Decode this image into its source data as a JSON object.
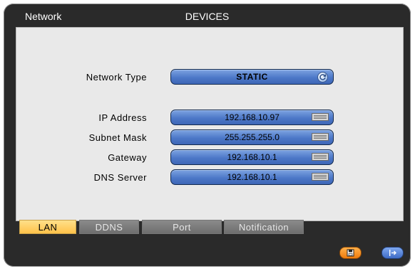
{
  "header": {
    "section": "Network",
    "title": "DEVICES"
  },
  "form": {
    "network_type": {
      "label": "Network Type",
      "value": "STATIC"
    },
    "ip_address": {
      "label": "IP Address",
      "value": "192.168.10.97"
    },
    "subnet_mask": {
      "label": "Subnet Mask",
      "value": "255.255.255.0"
    },
    "gateway": {
      "label": "Gateway",
      "value": "192.168.10.1"
    },
    "dns_server": {
      "label": "DNS Server",
      "value": "192.168.10.1"
    }
  },
  "tabs": [
    {
      "label": "LAN",
      "active": true
    },
    {
      "label": "DDNS",
      "active": false
    },
    {
      "label": "Port",
      "active": false
    },
    {
      "label": "Notification",
      "active": false
    }
  ],
  "actions": {
    "save_icon": "save-icon",
    "exit_icon": "exit-icon"
  },
  "colors": {
    "field_blue": "#4d78c8",
    "active_tab": "#ffc24a",
    "save_orange": "#ef7c0e",
    "exit_blue": "#3f6cc6"
  }
}
